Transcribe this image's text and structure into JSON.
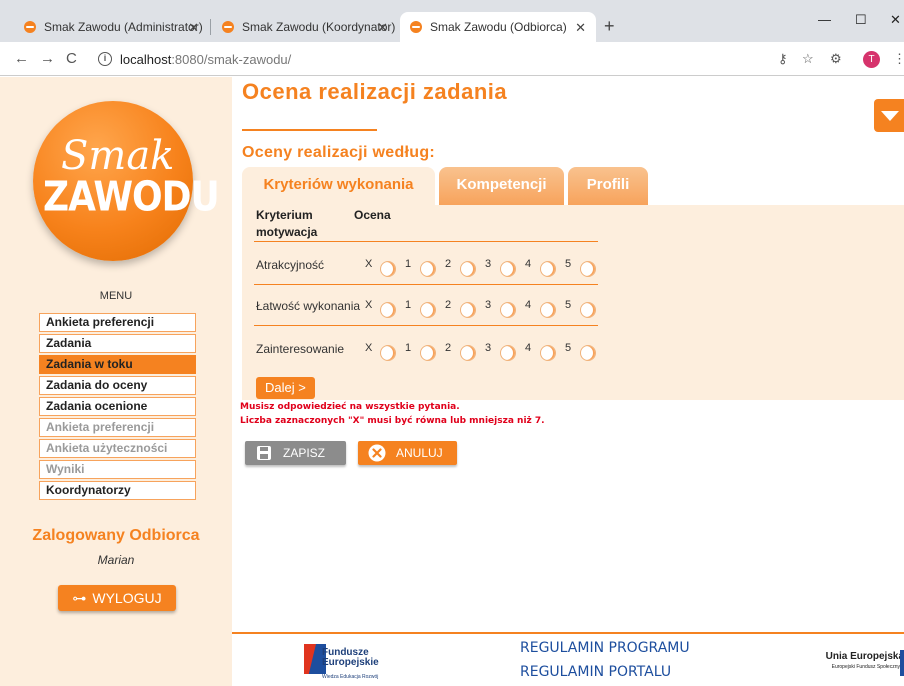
{
  "browser": {
    "tabs": [
      {
        "title": "Smak Zawodu (Administrator)",
        "active": false
      },
      {
        "title": "Smak Zawodu (Koordynator)",
        "active": false
      },
      {
        "title": "Smak Zawodu (Odbiorca)",
        "active": true
      }
    ],
    "url_host": "localhost",
    "url_path": ":8080/smak-zawodu/",
    "avatar_letter": "T"
  },
  "sidebar": {
    "logo_line1": "Smak",
    "logo_line2": "ZAWODU",
    "menu_title": "MENU",
    "items": [
      {
        "label": "Ankieta preferencji",
        "state": "normal"
      },
      {
        "label": "Zadania",
        "state": "normal"
      },
      {
        "label": "Zadania w toku",
        "state": "active"
      },
      {
        "label": "Zadania do oceny",
        "state": "normal"
      },
      {
        "label": "Zadania ocenione",
        "state": "normal"
      },
      {
        "label": "Ankieta preferencji",
        "state": "disabled"
      },
      {
        "label": "Ankieta użyteczności",
        "state": "disabled"
      },
      {
        "label": "Wyniki",
        "state": "disabled"
      },
      {
        "label": "Koordynatorzy",
        "state": "normal"
      }
    ],
    "logged_label": "Zalogowany Odbiorca",
    "user_name": "Marian",
    "logout_label": "WYLOGUJ"
  },
  "main": {
    "title": "Ocena realizacji zadania",
    "subtitle": "Oceny realizacji według:",
    "tabs": [
      {
        "label": "Kryteriów wykonania",
        "active": true
      },
      {
        "label": "Kompetencji",
        "active": false
      },
      {
        "label": "Profili",
        "active": false
      }
    ],
    "table": {
      "col_criterion": "Kryterium motywacja",
      "col_rating": "Ocena",
      "options": [
        "X",
        "1",
        "2",
        "3",
        "4",
        "5"
      ],
      "rows": [
        {
          "label": "Atrakcyjność"
        },
        {
          "label": "Łatwość wykonania"
        },
        {
          "label": "Zainteresowanie"
        }
      ]
    },
    "next_label": "Dalej >",
    "errors": [
      "Musisz odpowiedzieć na wszystkie pytania.",
      "Liczba zaznaczonych \"X\" musi być równa lub mniejsza niż 7."
    ],
    "save_label": "ZAPISZ",
    "cancel_label": "ANULUJ"
  },
  "footer": {
    "fe_line1": "Fundusze",
    "fe_line2": "Europejskie",
    "fe_sub": "Wiedza Edukacja Rozwój",
    "links": [
      "REGULAMIN PROGRAMU",
      "REGULAMIN PORTALU"
    ],
    "ue_title": "Unia Europejska",
    "ue_sub": "Europejski Fundusz Społeczny"
  },
  "colors": {
    "accent": "#f58220",
    "panel": "#fdeedd",
    "error": "#e0001b"
  }
}
